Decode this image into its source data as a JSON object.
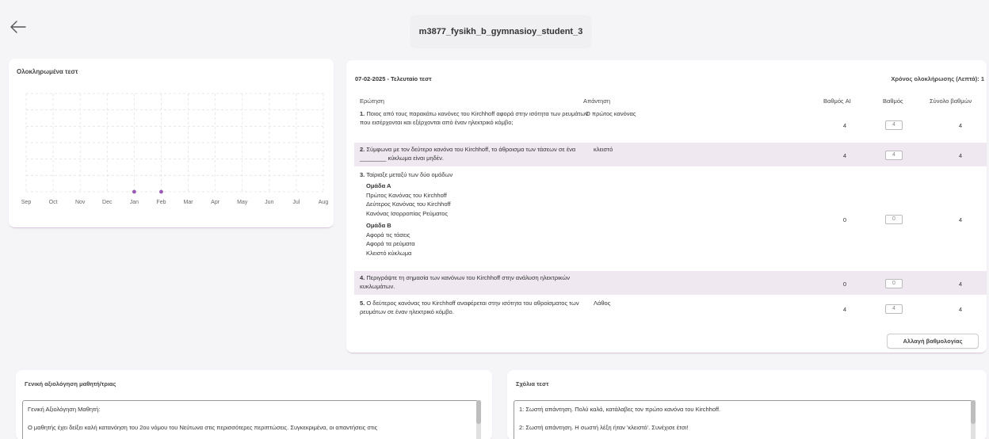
{
  "header": {
    "title": "m3877_fysikh_b_gymnasioy_student_3"
  },
  "completed_tests": {
    "title": "Ολοκληρωμένα τεστ"
  },
  "chart_data": {
    "type": "scatter",
    "categories": [
      "Sep",
      "Oct",
      "Nov",
      "Dec",
      "Jan",
      "Feb",
      "Mar",
      "Apr",
      "May",
      "Jun",
      "Jul",
      "Aug"
    ],
    "points": [
      {
        "x": "Jan",
        "y": 1
      },
      {
        "x": "Feb",
        "y": 1
      }
    ],
    "grid": true,
    "point_color": "#9b59b6"
  },
  "test": {
    "date_label": "07-02-2025 - Τελευταίο τεστ",
    "time_label": "Χρόνος ολοκλήρωσης (Λεπτά): 1",
    "headers": {
      "question": "Ερώτηση",
      "answer": "Απάντηση",
      "ai_grade": "Βαθμός AI",
      "grade": "Βαθμός",
      "total": "Σύνολο βαθμών"
    },
    "rows": [
      {
        "num": "1.",
        "question": "Ποιος από τους παρακάτω κανόνες του Kirchhoff αφορά στην ισότητα των ρευμάτων που εισέρχονται και εξέρχονται από έναν ηλεκτρικό κόμβο;",
        "answer": "Ο πρώτος κανόνας",
        "ai": "4",
        "grade": "4",
        "total": "4"
      },
      {
        "num": "2.",
        "question": "Σύμφωνα με τον δεύτερο κανόνα του Kirchhoff, το άθροισμα των τάσεων σε ένα ________ κύκλωμα είναι μηδέν.",
        "answer": "κλειστό",
        "ai": "4",
        "grade": "4",
        "total": "4"
      },
      {
        "num": "3.",
        "question": "Ταίριαξε μεταξύ των δύο ομάδων",
        "group_a_title": "Ομάδα Α",
        "group_a": [
          "Πρώτος Κανόνας του Kirchhoff",
          "Δεύτερος Κανόνας του Kirchhoff",
          "Κανόνας Ισορροπίας Ρεύματος"
        ],
        "group_b_title": "Ομάδα Β",
        "group_b": [
          "Αφορά τις τάσεις",
          "Αφορά τα ρεύματα",
          "Κλειστό κύκλωμα"
        ],
        "answer": "",
        "ai": "0",
        "grade": "0",
        "total": "4"
      },
      {
        "num": "4.",
        "question": "Περιγράψτε τη σημασία των κανόνων του Kirchhoff στην ανάλυση ηλεκτρικών κυκλωμάτων.",
        "answer": "",
        "ai": "0",
        "grade": "0",
        "total": "4"
      },
      {
        "num": "5.",
        "question": "Ο δεύτερος κανόνας του Kirchhoff αναφέρεται στην ισότητα του αθροίσματος των ρευμάτων σε έναν ηλεκτρικό κόμβο.",
        "answer": "Λάθος",
        "ai": "4",
        "grade": "4",
        "total": "4"
      }
    ],
    "change_button": "Αλλαγή βαθμολογίας"
  },
  "evaluation": {
    "title": "Γενική αξιολόγηση μαθητή/τριας",
    "heading": "Γενική Αξιολόγηση Μαθητή:",
    "text": "Ο μαθητής έχει δείξει καλή κατανόηση του 2ου νόμου του Νεύτωνα στις περισσότερες περιπτώσεις. Συγκεκριμένα, οι απαντήσεις στις"
  },
  "comments": {
    "title": "Σχόλια τεστ",
    "line1": "1: Σωστή απάντηση. Πολύ καλά, κατάλαβες τον πρώτο κανόνα του Kirchhoff.",
    "line2": "2: Σωστή απάντηση. Η σωστή λέξη ήταν 'κλειστό'. Συνέχισε έτσι!"
  }
}
